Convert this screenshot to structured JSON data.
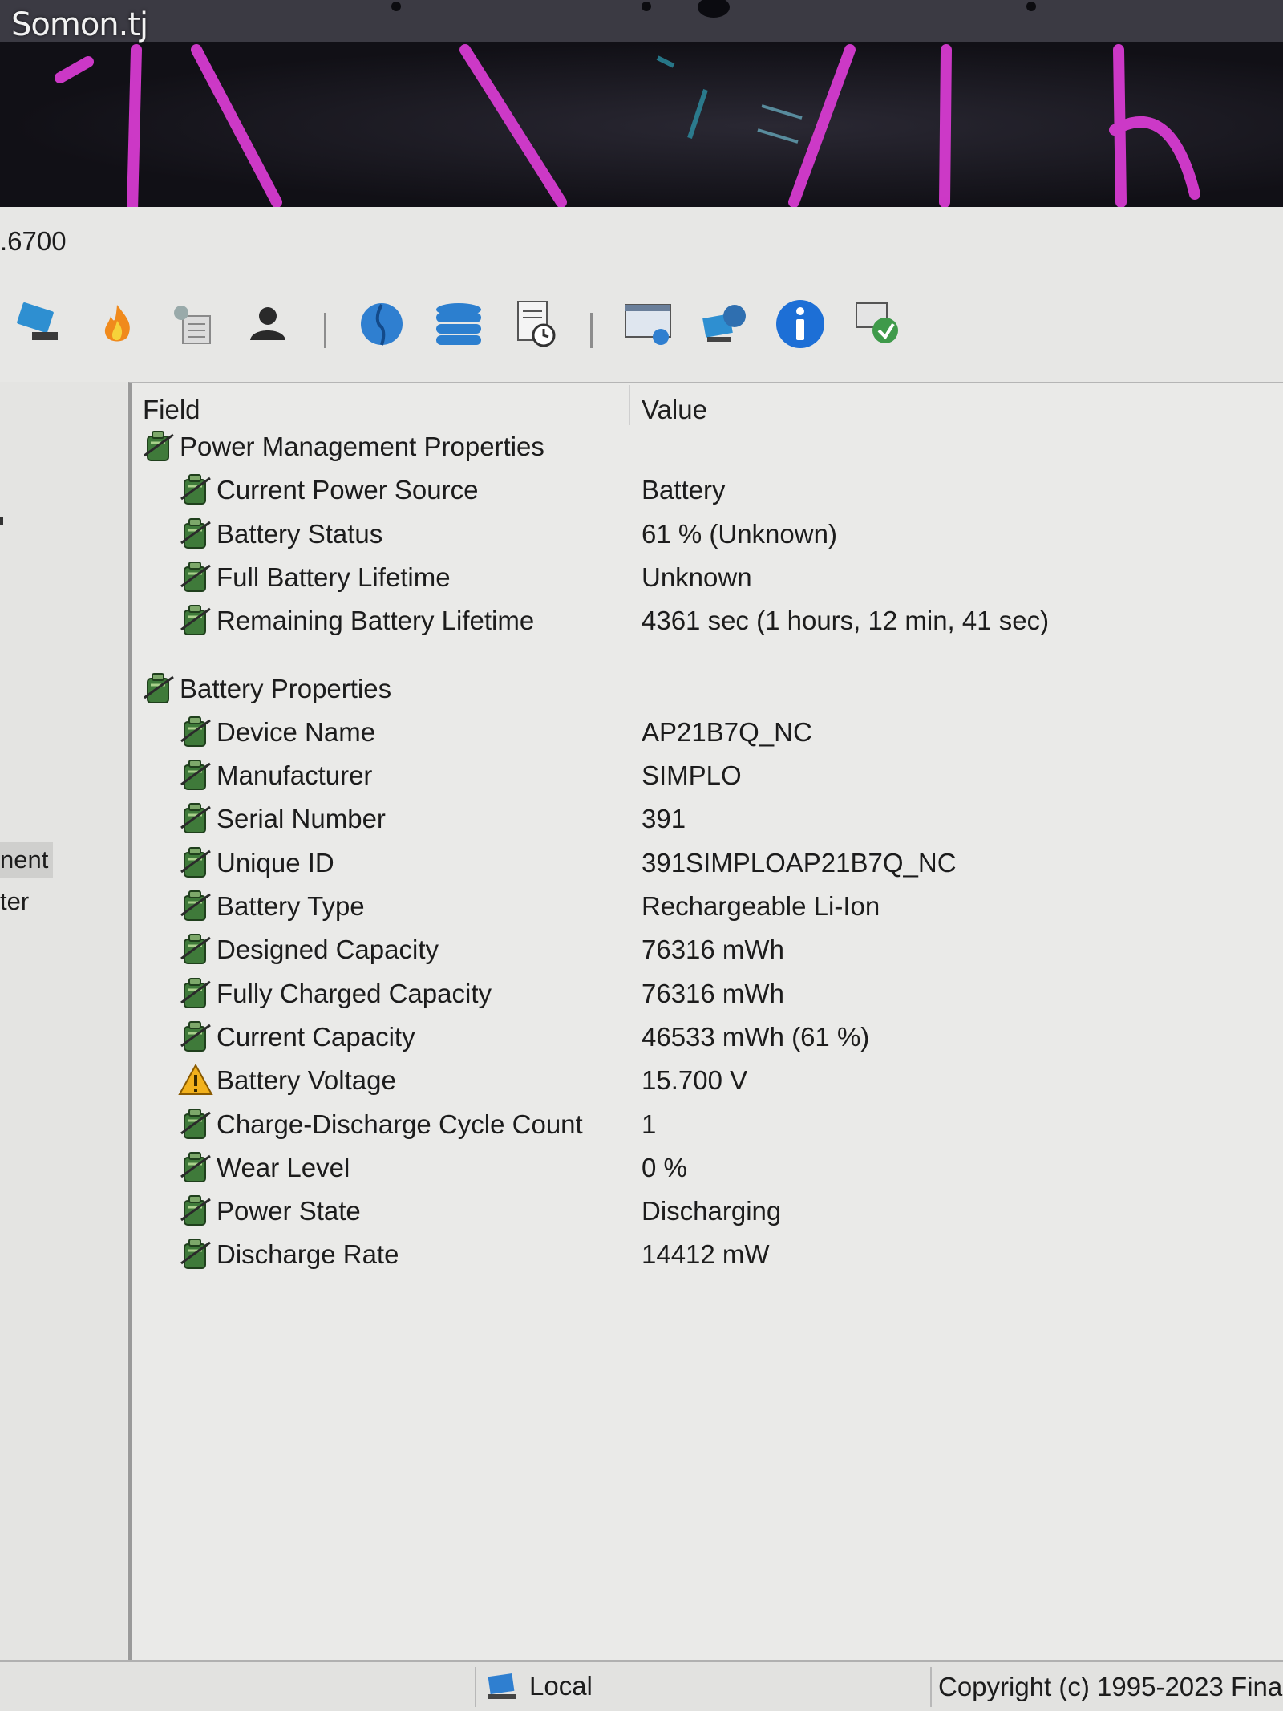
{
  "watermark": "Somon.tj",
  "window": {
    "title_fragment": ".6700"
  },
  "toolbar": {
    "icons": [
      "computer-icon",
      "flame-icon",
      "tools-icon",
      "user-icon",
      "globe-icon",
      "database-icon",
      "report-icon",
      "monitor-icon",
      "network-icon",
      "info-icon",
      "remote-icon"
    ]
  },
  "leftnav": {
    "items": [
      "nent",
      "ter"
    ]
  },
  "list": {
    "columns": {
      "field": "Field",
      "value": "Value"
    },
    "groups": [
      {
        "title": "Power Management Properties",
        "rows": [
          {
            "field": "Current Power Source",
            "value": "Battery"
          },
          {
            "field": "Battery Status",
            "value": "61 % (Unknown)"
          },
          {
            "field": "Full Battery Lifetime",
            "value": "Unknown"
          },
          {
            "field": "Remaining Battery Lifetime",
            "value": "4361 sec (1 hours, 12 min, 41 sec)"
          }
        ]
      },
      {
        "title": "Battery Properties",
        "rows": [
          {
            "field": "Device Name",
            "value": "AP21B7Q_NC"
          },
          {
            "field": "Manufacturer",
            "value": "SIMPLO"
          },
          {
            "field": "Serial Number",
            "value": "391"
          },
          {
            "field": "Unique ID",
            "value": "391SIMPLOAP21B7Q_NC"
          },
          {
            "field": "Battery Type",
            "value": "Rechargeable Li-Ion"
          },
          {
            "field": "Designed Capacity",
            "value": "76316 mWh"
          },
          {
            "field": "Fully Charged Capacity",
            "value": "76316 mWh"
          },
          {
            "field": "Current Capacity",
            "value": "46533 mWh  (61 %)"
          },
          {
            "field": "Battery Voltage",
            "value": "15.700 V",
            "icon": "warning-icon"
          },
          {
            "field": "Charge-Discharge Cycle Count",
            "value": "1"
          },
          {
            "field": "Wear Level",
            "value": "0 %"
          },
          {
            "field": "Power State",
            "value": "Discharging"
          },
          {
            "field": "Discharge Rate",
            "value": "14412 mW"
          }
        ]
      }
    ]
  },
  "statusbar": {
    "local": "Local",
    "copyright": "Copyright (c) 1995-2023 Fina"
  },
  "colors": {
    "window_bg": "#e7e7e5",
    "wallpaper_accent": "#d63bd0",
    "info_blue": "#1d6fd6"
  }
}
